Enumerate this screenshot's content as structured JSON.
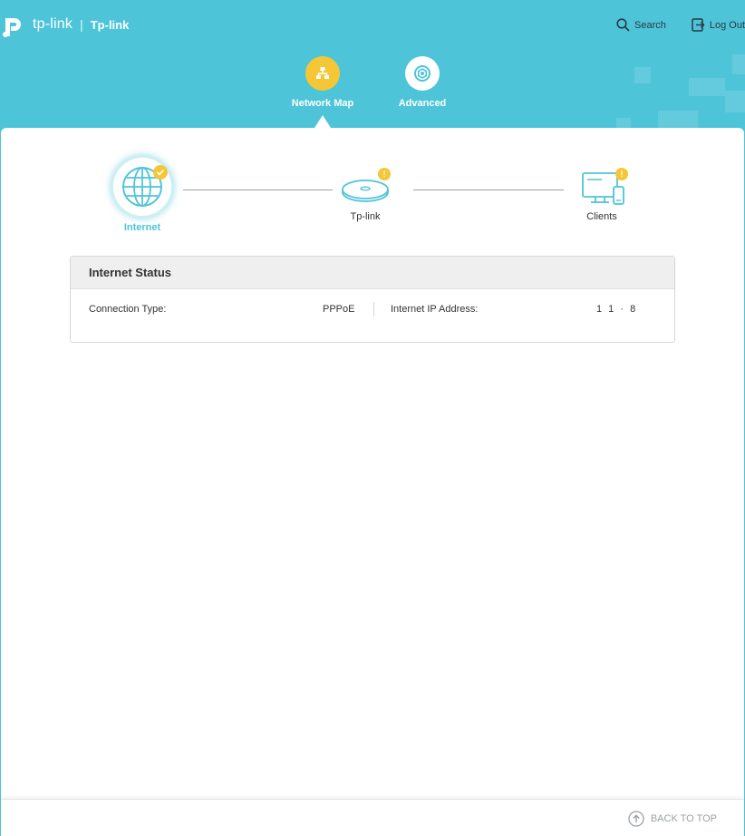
{
  "header": {
    "brand": "tp-link",
    "model": "Tp-link",
    "search_label": "Search",
    "logout_label": "Log Out",
    "tabs": [
      {
        "label": "Network Map",
        "icon": "network-map-icon",
        "active": true
      },
      {
        "label": "Advanced",
        "icon": "gear-icon",
        "active": false
      }
    ]
  },
  "topology": {
    "nodes": [
      {
        "label": "Internet",
        "icon": "globe-icon",
        "status": "check"
      },
      {
        "label": "Tp-link",
        "icon": "router-icon",
        "badge": "!"
      },
      {
        "label": "Clients",
        "icon": "monitor-phone-icon",
        "badge": "!"
      }
    ]
  },
  "internet_status": {
    "title": "Internet Status",
    "connection_type_label": "Connection Type:",
    "connection_type_value": "PPPoE",
    "ip_label": "Internet IP Address:",
    "ip_value": "1 1 · 8"
  },
  "footer": {
    "back_to_top": "BACK TO TOP"
  },
  "colors": {
    "header_bg": "#4ec4d9",
    "accent_yellow": "#f5c736",
    "active_label": "#4ec4d9"
  }
}
